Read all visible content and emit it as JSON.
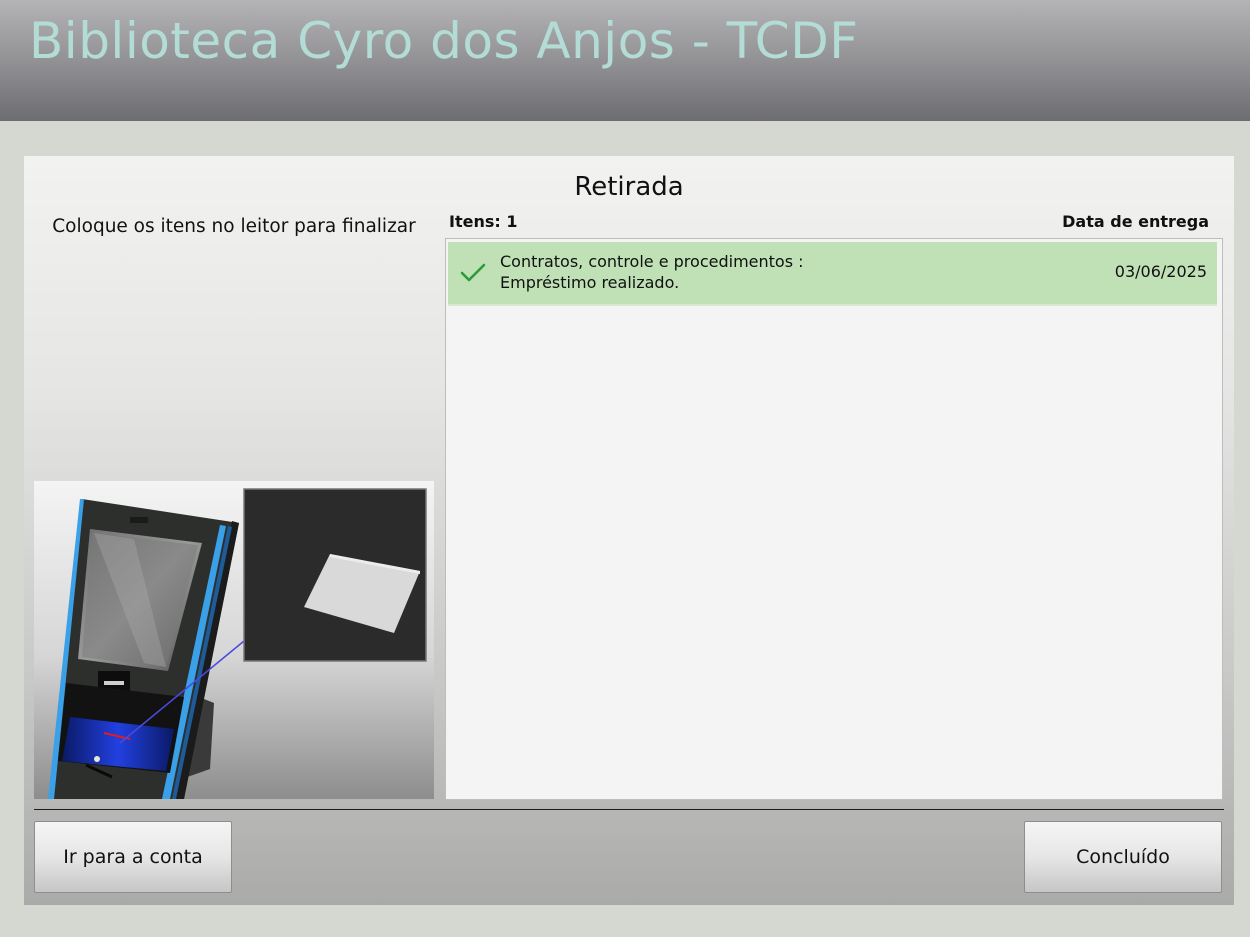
{
  "header": {
    "title": "Biblioteca Cyro dos Anjos - TCDF"
  },
  "checkout": {
    "title": "Retirada",
    "instruction": "Coloque os itens no leitor para finalizar",
    "items_count_label": "Itens: 1",
    "due_date_header": "Data de entrega",
    "items": [
      {
        "title": "Contratos, controle e procedimentos :",
        "status": "Empréstimo realizado.",
        "due_date": "03/06/2025",
        "status_icon": "check-icon",
        "row_color": "#c0e0b6"
      }
    ]
  },
  "buttons": {
    "account_label": "Ir para a conta",
    "done_label": "Concluído"
  },
  "colors": {
    "header_title": "#b3dcd7",
    "success_row": "#c0e0b6",
    "check": "#2e9a3a"
  }
}
